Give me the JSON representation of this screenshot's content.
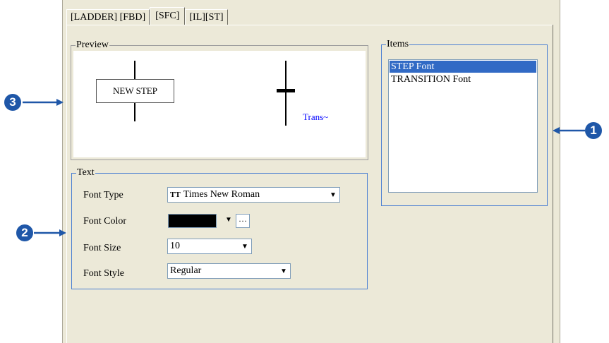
{
  "tabs": [
    {
      "label": "[LADDER] [FBD]"
    },
    {
      "label": "[SFC]"
    },
    {
      "label": "[IL][ST]"
    }
  ],
  "preview": {
    "legend": "Preview",
    "step_label": "NEW STEP",
    "transition_label": "Trans~"
  },
  "items": {
    "legend": "Items",
    "list": [
      "STEP Font",
      "TRANSITION Font"
    ],
    "selected": "STEP Font"
  },
  "text": {
    "legend": "Text",
    "font_type_label": "Font Type",
    "font_type_value": "Times New Roman",
    "font_type_icon": "TT",
    "font_color_label": "Font Color",
    "font_color_value": "#000000",
    "font_color_more": "···",
    "font_size_label": "Font Size",
    "font_size_value": "10",
    "font_style_label": "Font Style",
    "font_style_value": "Regular"
  },
  "callouts": {
    "one": "1",
    "two": "2",
    "three": "3"
  },
  "colors": {
    "callout": "#1f57a8",
    "selection": "#316ac5",
    "group_border": "#4a7fd2",
    "dialog_bg": "#ece9d8"
  }
}
